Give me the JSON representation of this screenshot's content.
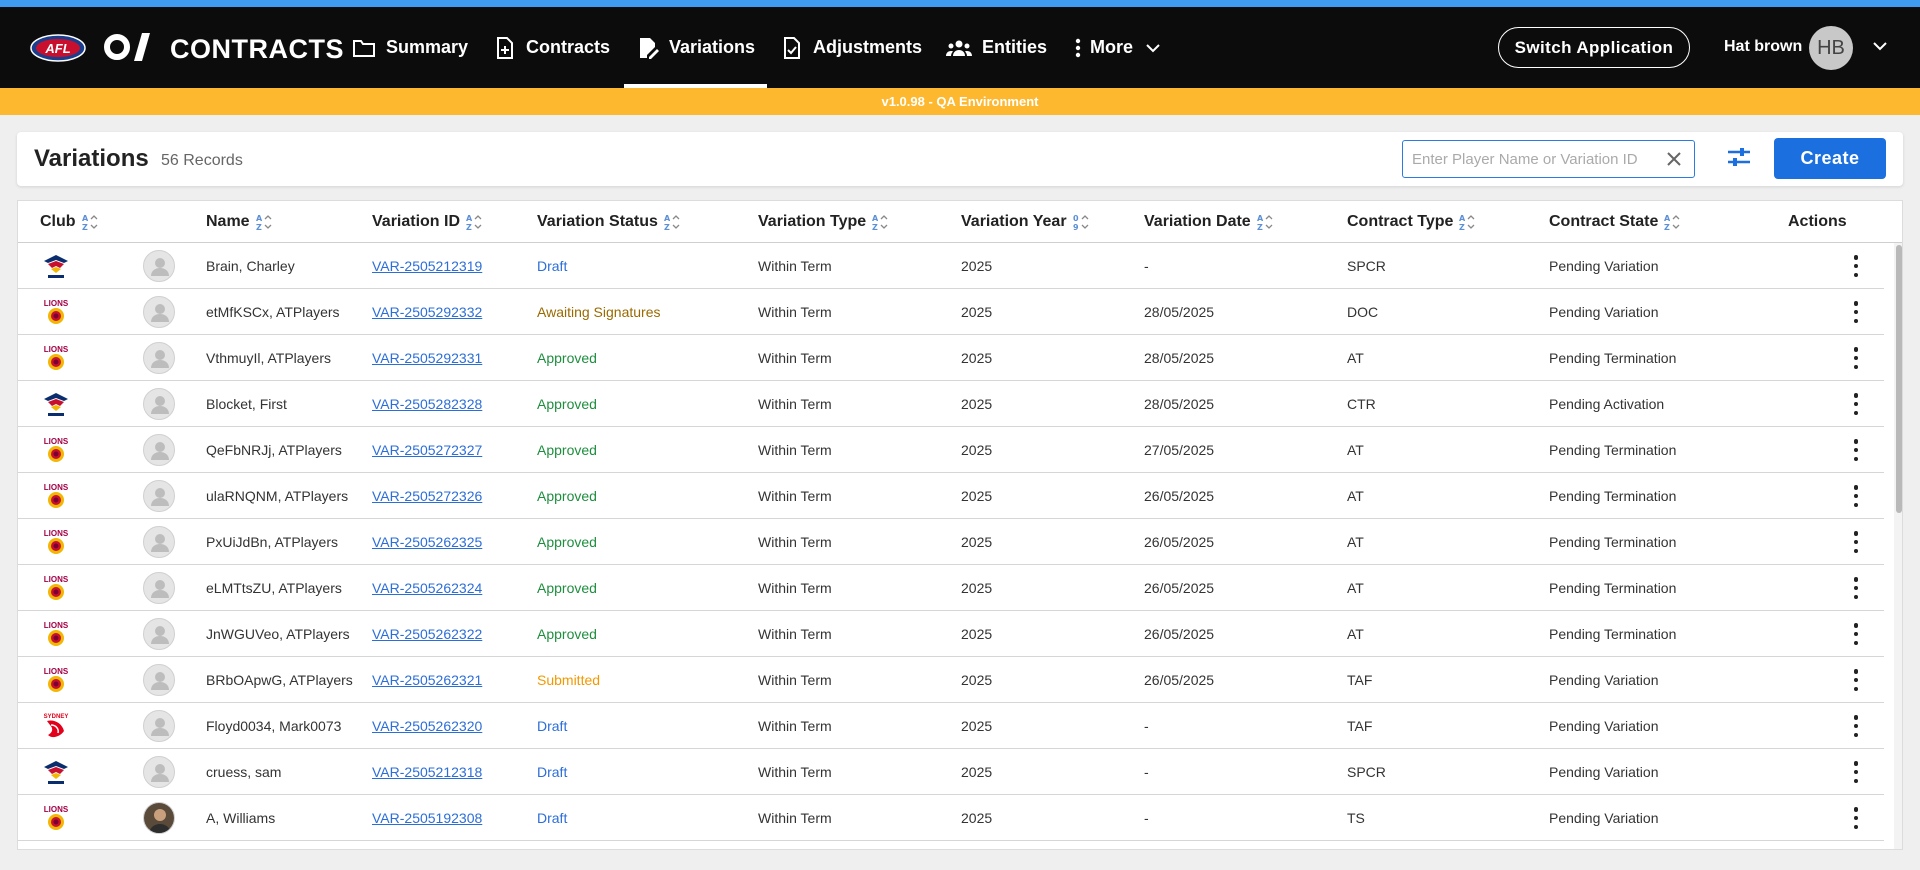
{
  "app": {
    "title": "CONTRACTS",
    "env_banner": "v1.0.98 - QA Environment"
  },
  "nav": {
    "items": [
      {
        "label": "Summary",
        "icon": "folder-icon"
      },
      {
        "label": "Contracts",
        "icon": "file-plus-icon"
      },
      {
        "label": "Variations",
        "icon": "file-edit-icon",
        "active": true
      },
      {
        "label": "Adjustments",
        "icon": "file-check-icon"
      },
      {
        "label": "Entities",
        "icon": "group-icon"
      },
      {
        "label": "More",
        "icon": "more-vertical-icon"
      }
    ],
    "switch_label": "Switch Application",
    "user_name": "Hat brown",
    "user_initials": "HB"
  },
  "page": {
    "title": "Variations",
    "record_count": "56 Records",
    "search_placeholder": "Enter Player Name or Variation ID",
    "create_label": "Create"
  },
  "table": {
    "columns": [
      "Club",
      "Name",
      "Variation ID",
      "Variation Status",
      "Variation Type",
      "Variation Year",
      "Variation Date",
      "Contract Type",
      "Contract State",
      "Actions"
    ],
    "rows": [
      {
        "club": "crows",
        "name": "Brain, Charley",
        "vid": "VAR-2505212319",
        "status": "Draft",
        "type": "Within Term",
        "year": "2025",
        "date": "-",
        "ctype": "SPCR",
        "state": "Pending Variation"
      },
      {
        "club": "lions",
        "name": "etMfKSCx, ATPlayers",
        "vid": "VAR-2505292332",
        "status": "Awaiting Signatures",
        "type": "Within Term",
        "year": "2025",
        "date": "28/05/2025",
        "ctype": "DOC",
        "state": "Pending Variation"
      },
      {
        "club": "lions",
        "name": "VthmuyIl, ATPlayers",
        "vid": "VAR-2505292331",
        "status": "Approved",
        "type": "Within Term",
        "year": "2025",
        "date": "28/05/2025",
        "ctype": "AT",
        "state": "Pending Termination"
      },
      {
        "club": "crows",
        "name": "Blocket, First",
        "vid": "VAR-2505282328",
        "status": "Approved",
        "type": "Within Term",
        "year": "2025",
        "date": "28/05/2025",
        "ctype": "CTR",
        "state": "Pending Activation"
      },
      {
        "club": "lions",
        "name": "QeFbNRJj, ATPlayers",
        "vid": "VAR-2505272327",
        "status": "Approved",
        "type": "Within Term",
        "year": "2025",
        "date": "27/05/2025",
        "ctype": "AT",
        "state": "Pending Termination"
      },
      {
        "club": "lions",
        "name": "ulaRNQNM, ATPlayers",
        "vid": "VAR-2505272326",
        "status": "Approved",
        "type": "Within Term",
        "year": "2025",
        "date": "26/05/2025",
        "ctype": "AT",
        "state": "Pending Termination"
      },
      {
        "club": "lions",
        "name": "PxUiJdBn, ATPlayers",
        "vid": "VAR-2505262325",
        "status": "Approved",
        "type": "Within Term",
        "year": "2025",
        "date": "26/05/2025",
        "ctype": "AT",
        "state": "Pending Termination"
      },
      {
        "club": "lions",
        "name": "eLMTtsZU, ATPlayers",
        "vid": "VAR-2505262324",
        "status": "Approved",
        "type": "Within Term",
        "year": "2025",
        "date": "26/05/2025",
        "ctype": "AT",
        "state": "Pending Termination"
      },
      {
        "club": "lions",
        "name": "JnWGUVeo, ATPlayers",
        "vid": "VAR-2505262322",
        "status": "Approved",
        "type": "Within Term",
        "year": "2025",
        "date": "26/05/2025",
        "ctype": "AT",
        "state": "Pending Termination"
      },
      {
        "club": "lions",
        "name": "BRbOApwG, ATPlayers",
        "vid": "VAR-2505262321",
        "status": "Submitted",
        "type": "Within Term",
        "year": "2025",
        "date": "26/05/2025",
        "ctype": "TAF",
        "state": "Pending Variation"
      },
      {
        "club": "swans",
        "name": "Floyd0034, Mark0073",
        "vid": "VAR-2505262320",
        "status": "Draft",
        "type": "Within Term",
        "year": "2025",
        "date": "-",
        "ctype": "TAF",
        "state": "Pending Variation"
      },
      {
        "club": "crows",
        "name": "cruess, sam",
        "vid": "VAR-2505212318",
        "status": "Draft",
        "type": "Within Term",
        "year": "2025",
        "date": "-",
        "ctype": "SPCR",
        "state": "Pending Variation"
      },
      {
        "club": "lions",
        "name": "A, Williams",
        "vid": "VAR-2505192308",
        "status": "Draft",
        "type": "Within Term",
        "year": "2025",
        "date": "-",
        "ctype": "TS",
        "state": "Pending Variation",
        "photo": true
      }
    ]
  },
  "colors": {
    "accent": "#1c6fde",
    "banner": "#fdb830",
    "draft": "#2c6ed8",
    "awaiting": "#9a6a00",
    "approved": "#1e8e3e",
    "submitted": "#f29900"
  }
}
